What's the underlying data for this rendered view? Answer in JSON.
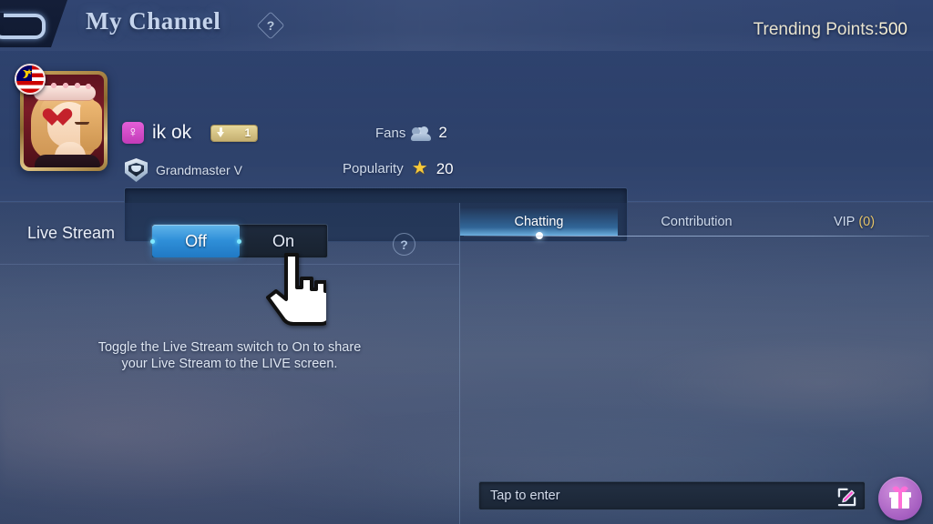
{
  "header": {
    "back_label": "Back",
    "title": "My Channel",
    "help_glyph": "?",
    "trending_label": "Trending Points:",
    "trending_value": "500"
  },
  "profile": {
    "avatar_alt": "Anime girl avatar with red heart",
    "flag_alt": "Malaysia flag",
    "gender_glyph": "♀",
    "nickname": "ik ok",
    "level_value": "1",
    "rank_label": "Grandmaster V",
    "stats": [
      {
        "label": "Fans",
        "icon": "people-icon",
        "value": "2"
      },
      {
        "label": "Popularity",
        "icon": "star-icon",
        "value": "20"
      }
    ],
    "bio_value": ""
  },
  "live_stream": {
    "label": "Live Stream",
    "options": [
      {
        "label": "Off",
        "selected": true
      },
      {
        "label": "On",
        "selected": false
      }
    ],
    "help_glyph": "?",
    "hint_line1": "Toggle the Live Stream switch to On to share",
    "hint_line2": "your Live Stream to the LIVE screen."
  },
  "chat": {
    "tabs": [
      {
        "label": "Chatting",
        "active": true
      },
      {
        "label": "Contribution",
        "active": false
      },
      {
        "label": "VIP",
        "count": "(0)",
        "active": false
      }
    ],
    "messages": [],
    "input_placeholder": "Tap to enter",
    "edit_icon": "pencil-edit-icon",
    "gift_icon": "gift-icon"
  },
  "colors": {
    "accent_blue": "#2f8fd8",
    "gold": "#e3c268",
    "panel_dark": "#1b2636",
    "gift_purple": "#a861c2"
  }
}
